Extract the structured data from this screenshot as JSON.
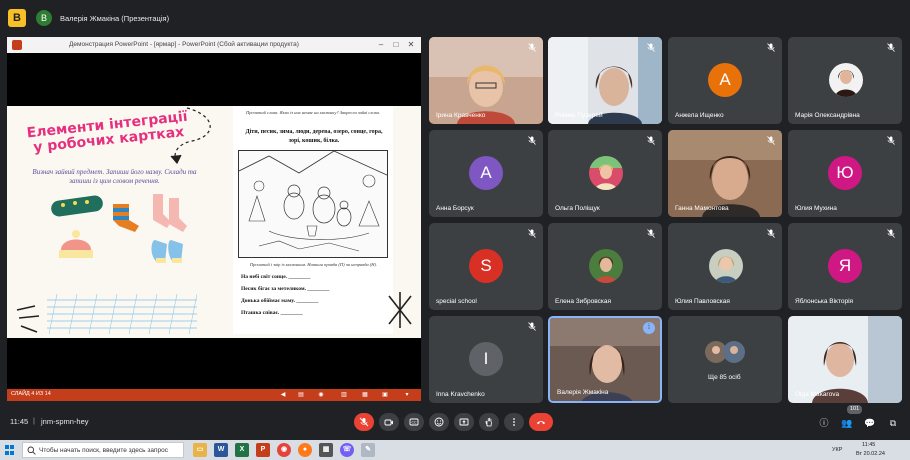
{
  "topbar": {
    "app_icon_letter": "B",
    "presenter_avatar_letter": "B",
    "presenter_label": "Валерія Жмакіна (Презентація)"
  },
  "ppt": {
    "window_title": "Демонстрация PowerPoint - [ярмар] - PowerPoint (Сбой активации продукта)",
    "status": "СЛАЙД 4 ИЗ 14",
    "slide_title": "Елементи інтеграції у робочих картках",
    "slide_task": "Визнач зайвий предмет. Запиши його назву. Склади та запиши із цим словом речення.",
    "ws_instruction1": "Прочитай слова. Яких із них немає на малюнку? Закресли зайві слова.",
    "ws_words": "Діти, песик, зима, люди, дерева, озеро, сонце, гора, зорі, кошик, білка.",
    "ws_instruction2": "Прочитай і звір із малюнком. Напиши правда (П) чи неправда (Н).",
    "ws_sentences": [
      "На небі світ сонце. ________",
      "Песик бігає за метеликом. ________",
      "Донька обіймає маму. ________",
      "Пташка співає. ________"
    ]
  },
  "participants": [
    {
      "name": "Ірина Кравченко",
      "type": "video"
    },
    {
      "name": "Римма Пузерей",
      "type": "video"
    },
    {
      "name": "Анжела Ищенко",
      "type": "avatar",
      "letter": "A",
      "color": "#e8710a"
    },
    {
      "name": "Марія Олександрівна",
      "type": "photo"
    },
    {
      "name": "Анна Борсук",
      "type": "avatar",
      "letter": "A",
      "color": "#7e57c2"
    },
    {
      "name": "Ольга Поліщук",
      "type": "photo"
    },
    {
      "name": "Ганна Мамонтова",
      "type": "video"
    },
    {
      "name": "Юлия Мухина",
      "type": "avatar",
      "letter": "Ю",
      "color": "#d01884"
    },
    {
      "name": "special school",
      "type": "avatar",
      "letter": "S",
      "color": "#d93025"
    },
    {
      "name": "Елена Зибровская",
      "type": "photo"
    },
    {
      "name": "Юлия Павловская",
      "type": "photo"
    },
    {
      "name": "Яблонська Вікторія",
      "type": "avatar",
      "letter": "Я",
      "color": "#d01884"
    },
    {
      "name": "Inna Kravchenko",
      "type": "avatar",
      "letter": "I",
      "color": "#5f6368"
    },
    {
      "name": "Валерія Жмакіна",
      "type": "video"
    },
    {
      "name": "Ще 85 осіб",
      "type": "group"
    },
    {
      "name": "Olga Makarova",
      "type": "video"
    }
  ],
  "bottombar": {
    "time": "11:45",
    "separator": "|",
    "meeting_code": "jnm-spmn-hey",
    "participant_count": "101"
  },
  "taskbar": {
    "search_placeholder": "Чтобы начать поиск, введите здесь запрос",
    "language": "УКР",
    "clock_time": "11:45",
    "clock_date": "Вт 20.02.24"
  },
  "colors": {
    "meet_bg": "#202124",
    "tile_bg": "#3c4043",
    "end_call": "#ea4335",
    "ppt_red": "#c43e1c",
    "slide_title_pink": "#e6307f",
    "active_speaker": "#8ab4f8"
  }
}
